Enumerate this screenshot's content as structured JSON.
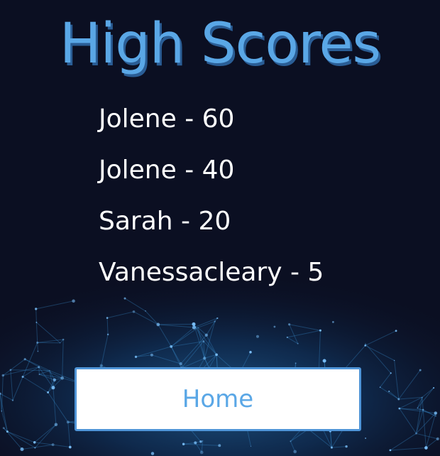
{
  "title": "High Scores",
  "scores": [
    {
      "text": "Jolene - 60"
    },
    {
      "text": "Jolene - 40"
    },
    {
      "text": "Sarah - 20"
    },
    {
      "text": "Vanessacleary - 5"
    }
  ],
  "home_label": "Home",
  "background": {
    "base_color": "#0b0f22",
    "glow_color": "#2f8fd6",
    "icon": "network-particles"
  },
  "colors": {
    "title": "#5aa7e6",
    "title_shadow": "#2a5d95",
    "score_text": "#ffffff",
    "button_bg": "#ffffff",
    "button_border": "#4f95d8",
    "button_text": "#5aa7e6"
  }
}
